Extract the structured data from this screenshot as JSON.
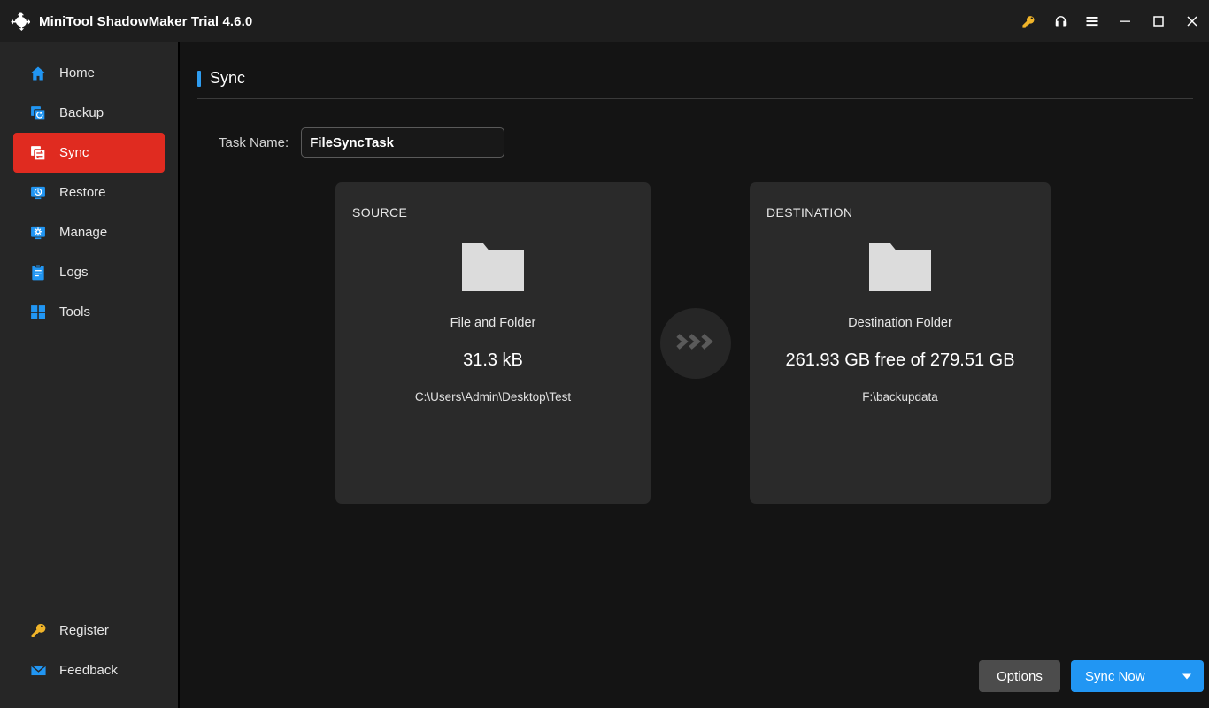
{
  "window": {
    "title": "MiniTool ShadowMaker Trial 4.6.0",
    "logo_icon": "sync-arrows-logo",
    "controls": [
      {
        "name": "key-icon",
        "label": ""
      },
      {
        "name": "headset-icon",
        "label": ""
      },
      {
        "name": "menu-icon",
        "label": ""
      },
      {
        "name": "minimize-icon",
        "label": ""
      },
      {
        "name": "maximize-icon",
        "label": ""
      },
      {
        "name": "close-icon",
        "label": ""
      }
    ]
  },
  "sidebar": {
    "items": [
      {
        "label": "Home",
        "icon": "home-icon",
        "active": false
      },
      {
        "label": "Backup",
        "icon": "backup-icon",
        "active": false
      },
      {
        "label": "Sync",
        "icon": "sync-icon",
        "active": true
      },
      {
        "label": "Restore",
        "icon": "restore-icon",
        "active": false
      },
      {
        "label": "Manage",
        "icon": "manage-icon",
        "active": false
      },
      {
        "label": "Logs",
        "icon": "logs-icon",
        "active": false
      },
      {
        "label": "Tools",
        "icon": "tools-icon",
        "active": false
      }
    ],
    "bottom_items": [
      {
        "label": "Register",
        "icon": "key-icon"
      },
      {
        "label": "Feedback",
        "icon": "envelope-icon"
      }
    ]
  },
  "page": {
    "title": "Sync",
    "accent_color": "#2e9cf0"
  },
  "task": {
    "label": "Task Name:",
    "value": "FileSyncTask",
    "placeholder": "Task Name"
  },
  "source_panel": {
    "kicker": "SOURCE",
    "icon": "folder-icon",
    "type": "File and Folder",
    "size": "31.3 kB",
    "path": "C:\\Users\\Admin\\Desktop\\Test"
  },
  "destination_panel": {
    "kicker": "DESTINATION",
    "icon": "folder-icon",
    "type": "Destination Folder",
    "size": "261.93 GB free of 279.51 GB",
    "path": "F:\\backupdata"
  },
  "transfer_arrow": {
    "icon": "triple-chevron-right-icon"
  },
  "footer": {
    "options_label": "Options",
    "sync_label": "Sync Now",
    "sync_color": "#2196f3",
    "dropdown_icon": "caret-down-icon"
  }
}
